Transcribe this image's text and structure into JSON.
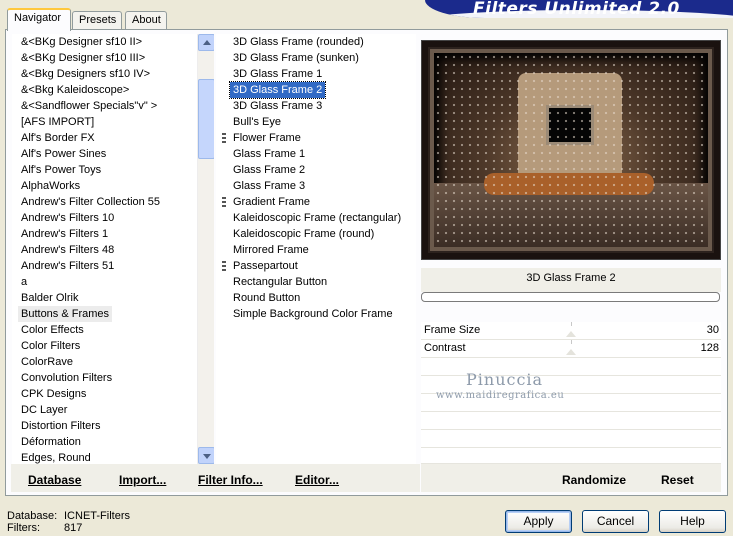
{
  "header": {
    "title": "Filters Unlimited 2.0"
  },
  "tabs": [
    {
      "label": "Navigator"
    },
    {
      "label": "Presets"
    },
    {
      "label": "About"
    }
  ],
  "categories": {
    "selected": "Buttons & Frames",
    "items": [
      "&<BKg Designer sf10 II>",
      "&<BKg Designer sf10 III>",
      "&<Bkg Designers sf10 IV>",
      "&<Bkg Kaleidoscope>",
      "&<Sandflower Specials\"v\" >",
      "[AFS IMPORT]",
      "Alf's Border FX",
      "Alf's Power Sines",
      "Alf's Power Toys",
      "AlphaWorks",
      "Andrew's Filter Collection 55",
      "Andrew's Filters 10",
      "Andrew's Filters 1",
      "Andrew's Filters 48",
      "Andrew's Filters 51",
      "a",
      "Balder Olrik",
      "Buttons & Frames",
      "Color Effects",
      "Color Filters",
      "ColorRave",
      "Convolution Filters",
      "CPK Designs",
      "DC Layer",
      "Distortion Filters",
      "Déformation",
      "Edges, Round"
    ]
  },
  "filters": {
    "selected": "3D Glass Frame 2",
    "items": [
      {
        "label": "3D Glass Frame (rounded)",
        "group": false
      },
      {
        "label": "3D Glass Frame (sunken)",
        "group": false
      },
      {
        "label": "3D Glass Frame 1",
        "group": false
      },
      {
        "label": "3D Glass Frame 2",
        "group": false
      },
      {
        "label": "3D Glass Frame 3",
        "group": false
      },
      {
        "label": "Bull's Eye",
        "group": false
      },
      {
        "label": "Flower Frame",
        "group": true
      },
      {
        "label": "Glass Frame 1",
        "group": false
      },
      {
        "label": "Glass Frame 2",
        "group": false
      },
      {
        "label": "Glass Frame 3",
        "group": false
      },
      {
        "label": "Gradient Frame",
        "group": true
      },
      {
        "label": "Kaleidoscopic Frame (rectangular)",
        "group": false
      },
      {
        "label": "Kaleidoscopic Frame (round)",
        "group": false
      },
      {
        "label": "Mirrored Frame",
        "group": false
      },
      {
        "label": "Passepartout",
        "group": true
      },
      {
        "label": "Rectangular Button",
        "group": false
      },
      {
        "label": "Round Button",
        "group": false
      },
      {
        "label": "Simple Background Color Frame",
        "group": false
      }
    ]
  },
  "left_toolbar": {
    "database_label": "Database",
    "import_label": "Import...",
    "filter_info_label": "Filter Info...",
    "editor_label": "Editor..."
  },
  "preview": {
    "filter_name": "3D Glass Frame 2",
    "progress_fraction": 0
  },
  "params": [
    {
      "label": "Frame Size",
      "value": "30"
    },
    {
      "label": "Contrast",
      "value": "128"
    }
  ],
  "watermark": {
    "name": "Pinuccia",
    "url": "www.maidiregrafica.eu"
  },
  "right_toolbar": {
    "randomize_label": "Randomize",
    "reset_label": "Reset"
  },
  "status": {
    "database_label": "Database:",
    "database_value": "ICNET-Filters",
    "filters_label": "Filters:",
    "filters_value": "817"
  },
  "dialog_buttons": {
    "apply": "Apply",
    "cancel": "Cancel",
    "help": "Help"
  },
  "colors": {
    "selection": "#316ac5",
    "banner": "#1b2a8c",
    "face": "#ece9d8"
  }
}
